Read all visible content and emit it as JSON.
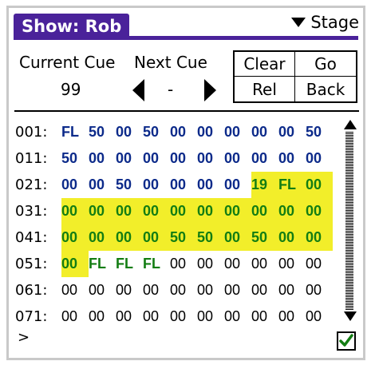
{
  "title": "Show: Rob",
  "stage_selector": {
    "label": "Stage",
    "icon": "triangle-down-icon"
  },
  "current_cue": {
    "label": "Current Cue",
    "value": "99"
  },
  "next_cue": {
    "label": "Next Cue",
    "value": "-"
  },
  "buttons": {
    "clear": "Clear",
    "go": "Go",
    "rel": "Rel",
    "back": "Back"
  },
  "colors": {
    "title_bg": "#4a229a",
    "blue_text": "#0c2a8a",
    "green_text": "#137d13",
    "highlight": "#f2ee2a"
  },
  "rows": [
    {
      "addr": "001:",
      "cells": [
        {
          "v": "FL",
          "c": "blue"
        },
        {
          "v": "50",
          "c": "blue"
        },
        {
          "v": "00",
          "c": "blue"
        },
        {
          "v": "50",
          "c": "blue"
        },
        {
          "v": "00",
          "c": "blue"
        },
        {
          "v": "00",
          "c": "blue"
        },
        {
          "v": "00",
          "c": "blue"
        },
        {
          "v": "00",
          "c": "blue"
        },
        {
          "v": "00",
          "c": "blue"
        },
        {
          "v": "50",
          "c": "blue"
        }
      ]
    },
    {
      "addr": "011:",
      "cells": [
        {
          "v": "50",
          "c": "blue"
        },
        {
          "v": "00",
          "c": "blue"
        },
        {
          "v": "00",
          "c": "blue"
        },
        {
          "v": "00",
          "c": "blue"
        },
        {
          "v": "00",
          "c": "blue"
        },
        {
          "v": "00",
          "c": "blue"
        },
        {
          "v": "00",
          "c": "blue"
        },
        {
          "v": "00",
          "c": "blue"
        },
        {
          "v": "00",
          "c": "blue"
        },
        {
          "v": "00",
          "c": "blue"
        }
      ]
    },
    {
      "addr": "021:",
      "cells": [
        {
          "v": "00",
          "c": "blue"
        },
        {
          "v": "00",
          "c": "blue"
        },
        {
          "v": "50",
          "c": "blue"
        },
        {
          "v": "00",
          "c": "blue"
        },
        {
          "v": "00",
          "c": "blue"
        },
        {
          "v": "00",
          "c": "blue"
        },
        {
          "v": "00",
          "c": "blue"
        },
        {
          "v": "19",
          "c": "green",
          "hl": true
        },
        {
          "v": "FL",
          "c": "green",
          "hl": true
        },
        {
          "v": "00",
          "c": "green",
          "hl": true
        }
      ]
    },
    {
      "addr": "031:",
      "cells": [
        {
          "v": "00",
          "c": "green",
          "hl": true
        },
        {
          "v": "00",
          "c": "green",
          "hl": true
        },
        {
          "v": "00",
          "c": "green",
          "hl": true
        },
        {
          "v": "00",
          "c": "green",
          "hl": true
        },
        {
          "v": "00",
          "c": "green",
          "hl": true
        },
        {
          "v": "00",
          "c": "green",
          "hl": true
        },
        {
          "v": "00",
          "c": "green",
          "hl": true
        },
        {
          "v": "00",
          "c": "green",
          "hl": true
        },
        {
          "v": "00",
          "c": "green",
          "hl": true
        },
        {
          "v": "00",
          "c": "green",
          "hl": true
        }
      ]
    },
    {
      "addr": "041:",
      "cells": [
        {
          "v": "00",
          "c": "green",
          "hl": true
        },
        {
          "v": "00",
          "c": "green",
          "hl": true
        },
        {
          "v": "00",
          "c": "green",
          "hl": true
        },
        {
          "v": "00",
          "c": "green",
          "hl": true
        },
        {
          "v": "50",
          "c": "green",
          "hl": true
        },
        {
          "v": "50",
          "c": "green",
          "hl": true
        },
        {
          "v": "00",
          "c": "green",
          "hl": true
        },
        {
          "v": "50",
          "c": "green",
          "hl": true
        },
        {
          "v": "00",
          "c": "green",
          "hl": true
        },
        {
          "v": "00",
          "c": "green",
          "hl": true
        }
      ]
    },
    {
      "addr": "051:",
      "cells": [
        {
          "v": "00",
          "c": "green",
          "hl": true
        },
        {
          "v": "FL",
          "c": "green"
        },
        {
          "v": "FL",
          "c": "green"
        },
        {
          "v": "FL",
          "c": "green"
        },
        {
          "v": "00",
          "c": "normal"
        },
        {
          "v": "00",
          "c": "normal"
        },
        {
          "v": "00",
          "c": "normal"
        },
        {
          "v": "00",
          "c": "normal"
        },
        {
          "v": "00",
          "c": "normal"
        },
        {
          "v": "00",
          "c": "normal"
        }
      ]
    },
    {
      "addr": "061:",
      "cells": [
        {
          "v": "00",
          "c": "normal"
        },
        {
          "v": "00",
          "c": "normal"
        },
        {
          "v": "00",
          "c": "normal"
        },
        {
          "v": "00",
          "c": "normal"
        },
        {
          "v": "00",
          "c": "normal"
        },
        {
          "v": "00",
          "c": "normal"
        },
        {
          "v": "00",
          "c": "normal"
        },
        {
          "v": "00",
          "c": "normal"
        },
        {
          "v": "00",
          "c": "normal"
        },
        {
          "v": "00",
          "c": "normal"
        }
      ]
    },
    {
      "addr": "071:",
      "cells": [
        {
          "v": "00",
          "c": "normal"
        },
        {
          "v": "00",
          "c": "normal"
        },
        {
          "v": "00",
          "c": "normal"
        },
        {
          "v": "00",
          "c": "normal"
        },
        {
          "v": "00",
          "c": "normal"
        },
        {
          "v": "00",
          "c": "normal"
        },
        {
          "v": "00",
          "c": "normal"
        },
        {
          "v": "00",
          "c": "normal"
        },
        {
          "v": "00",
          "c": "normal"
        },
        {
          "v": "00",
          "c": "normal"
        }
      ]
    }
  ],
  "prompt": ">",
  "confirm_checkbox": {
    "checked": true,
    "icon": "checkmark-icon"
  }
}
